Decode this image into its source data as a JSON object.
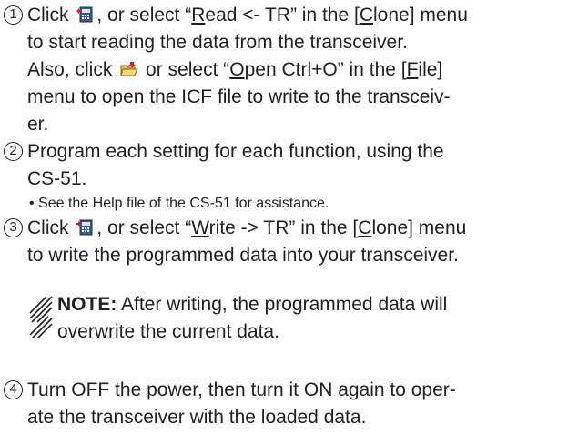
{
  "steps": [
    {
      "number": "1",
      "line1_a": "Click",
      "line1_b": ", or select “",
      "line1_u": "R",
      "line1_c": "ead <- TR” in the [",
      "line1_u2": "C",
      "line1_d": "lone] menu",
      "line2": "to start reading the data from the transceiver.",
      "line3_a": "Also, click",
      "line3_b": "or select “",
      "line3_u": "O",
      "line3_c": "pen Ctrl+O” in the [",
      "line3_u2": "F",
      "line3_d": "ile]",
      "line4": "menu to open the ICF file to write to the transceiv-",
      "line5": "er.",
      "read_icon": "read-from-transceiver-icon",
      "open_icon": "open-folder-icon"
    },
    {
      "number": "2",
      "line1": "Program each setting for each function, using the",
      "line2": "CS-51.",
      "bullet": "• See the Help file of the CS-51 for assistance."
    },
    {
      "number": "3",
      "line1_a": "Click",
      "line1_b": ", or select “",
      "line1_u": "W",
      "line1_c": "rite -> TR” in the [",
      "line1_u2": "C",
      "line1_d": "lone] menu",
      "line2": "to write the programmed data into your transceiver.",
      "write_icon": "write-to-transceiver-icon"
    },
    {
      "number": "4",
      "line1": "Turn OFF the power, then turn it ON again to oper-",
      "line2": "ate the transceiver with the loaded data."
    }
  ],
  "note": {
    "label": "NOTE:",
    "line1": " After writing, the programmed data will",
    "line2": "overwrite the current data.",
    "icon": "note-hatch-icon"
  }
}
